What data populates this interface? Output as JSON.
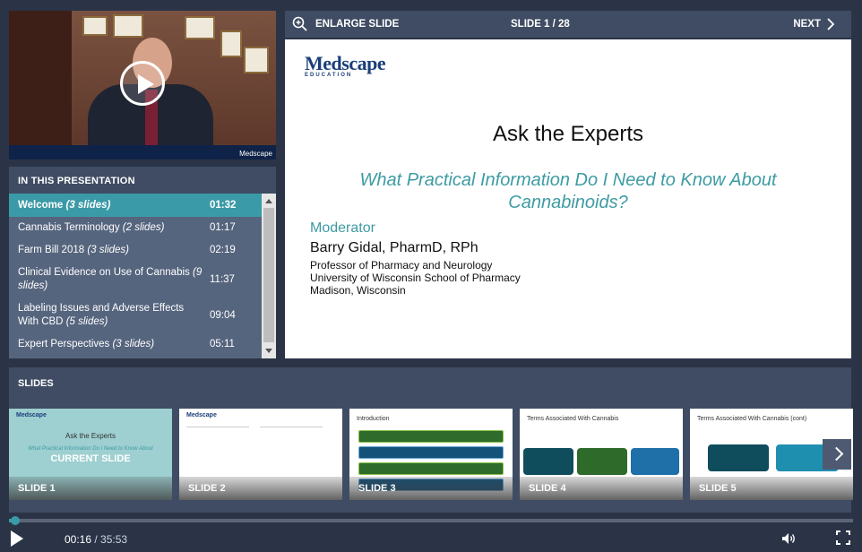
{
  "video": {
    "logo": "Medscape"
  },
  "presentation": {
    "header": "IN THIS PRESENTATION",
    "items": [
      {
        "title": "Welcome",
        "count": "(3 slides)",
        "duration": "01:32",
        "active": true
      },
      {
        "title": "Cannabis Terminology",
        "count": "(2 slides)",
        "duration": "01:17"
      },
      {
        "title": "Farm Bill 2018",
        "count": "(3 slides)",
        "duration": "02:19"
      },
      {
        "title": "Clinical Evidence on Use of Cannabis",
        "count": "(9 slides)",
        "duration": "11:37"
      },
      {
        "title": "Labeling Issues and Adverse Effects With CBD",
        "count": "(5 slides)",
        "duration": "09:04"
      },
      {
        "title": "Expert Perspectives",
        "count": "(3 slides)",
        "duration": "05:11"
      }
    ]
  },
  "toolbar": {
    "enlarge": "ENLARGE SLIDE",
    "counter": "SLIDE 1 / 28",
    "next": "NEXT"
  },
  "slide": {
    "logo": "Medscape",
    "logo_sub": "EDUCATION",
    "title": "Ask the Experts",
    "subtitle": "What Practical Information Do I Need to Know About Cannabinoids?",
    "moderator_label": "Moderator",
    "name": "Barry Gidal, PharmD, RPh",
    "line1": "Professor of Pharmacy and Neurology",
    "line2": "University of Wisconsin School of Pharmacy",
    "line3": "Madison, Wisconsin"
  },
  "slides": {
    "header": "SLIDES",
    "current_label": "CURRENT SLIDE",
    "thumbs": [
      {
        "label": "SLIDE 1"
      },
      {
        "label": "SLIDE 2"
      },
      {
        "label": "SLIDE 3",
        "title": "Introduction"
      },
      {
        "label": "SLIDE 4",
        "title": "Terms Associated With Cannabis"
      },
      {
        "label": "SLIDE 5",
        "title": "Terms Associated With Cannabis (cont)"
      }
    ]
  },
  "player": {
    "current_time": "00:16",
    "total_time": "35:53",
    "progress": 0.0074
  }
}
